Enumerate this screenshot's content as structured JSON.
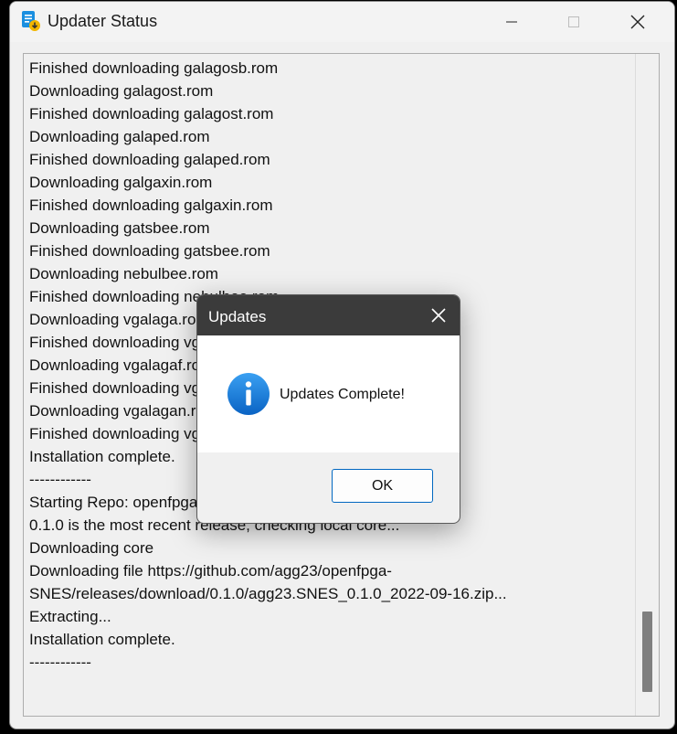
{
  "window": {
    "title": "Updater Status"
  },
  "log": {
    "lines": [
      "Finished downloading galagosb.rom",
      "Downloading galagost.rom",
      "Finished downloading galagost.rom",
      "Downloading galaped.rom",
      "Finished downloading galaped.rom",
      "Downloading galgaxin.rom",
      "Finished downloading galgaxin.rom",
      "Downloading gatsbee.rom",
      "Finished downloading gatsbee.rom",
      "Downloading nebulbee.rom",
      "Finished downloading nebulbee.rom",
      "Downloading vgalaga.rom",
      "Finished downloading vgalaga.rom",
      "Downloading vgalagaf.rom",
      "Finished downloading vgalagaf.rom",
      "Downloading vgalagan.rom",
      "Finished downloading vgalagan.rom",
      "Installation complete.",
      "------------",
      "Starting Repo: openfpga",
      "0.1.0 is the most recent release, checking local core...",
      "Downloading core",
      "Downloading file https://github.com/agg23/openfpga-",
      "SNES/releases/download/0.1.0/agg23.SNES_0.1.0_2022-09-16.zip...",
      "Extracting...",
      "Installation complete.",
      "------------"
    ]
  },
  "dialog": {
    "title": "Updates",
    "message": "Updates Complete!",
    "ok_label": "OK",
    "icon": "info-icon"
  },
  "colors": {
    "dialog_titlebar": "#3b3b3b",
    "info_icon": "#0a74d6",
    "button_border": "#0067c0"
  }
}
